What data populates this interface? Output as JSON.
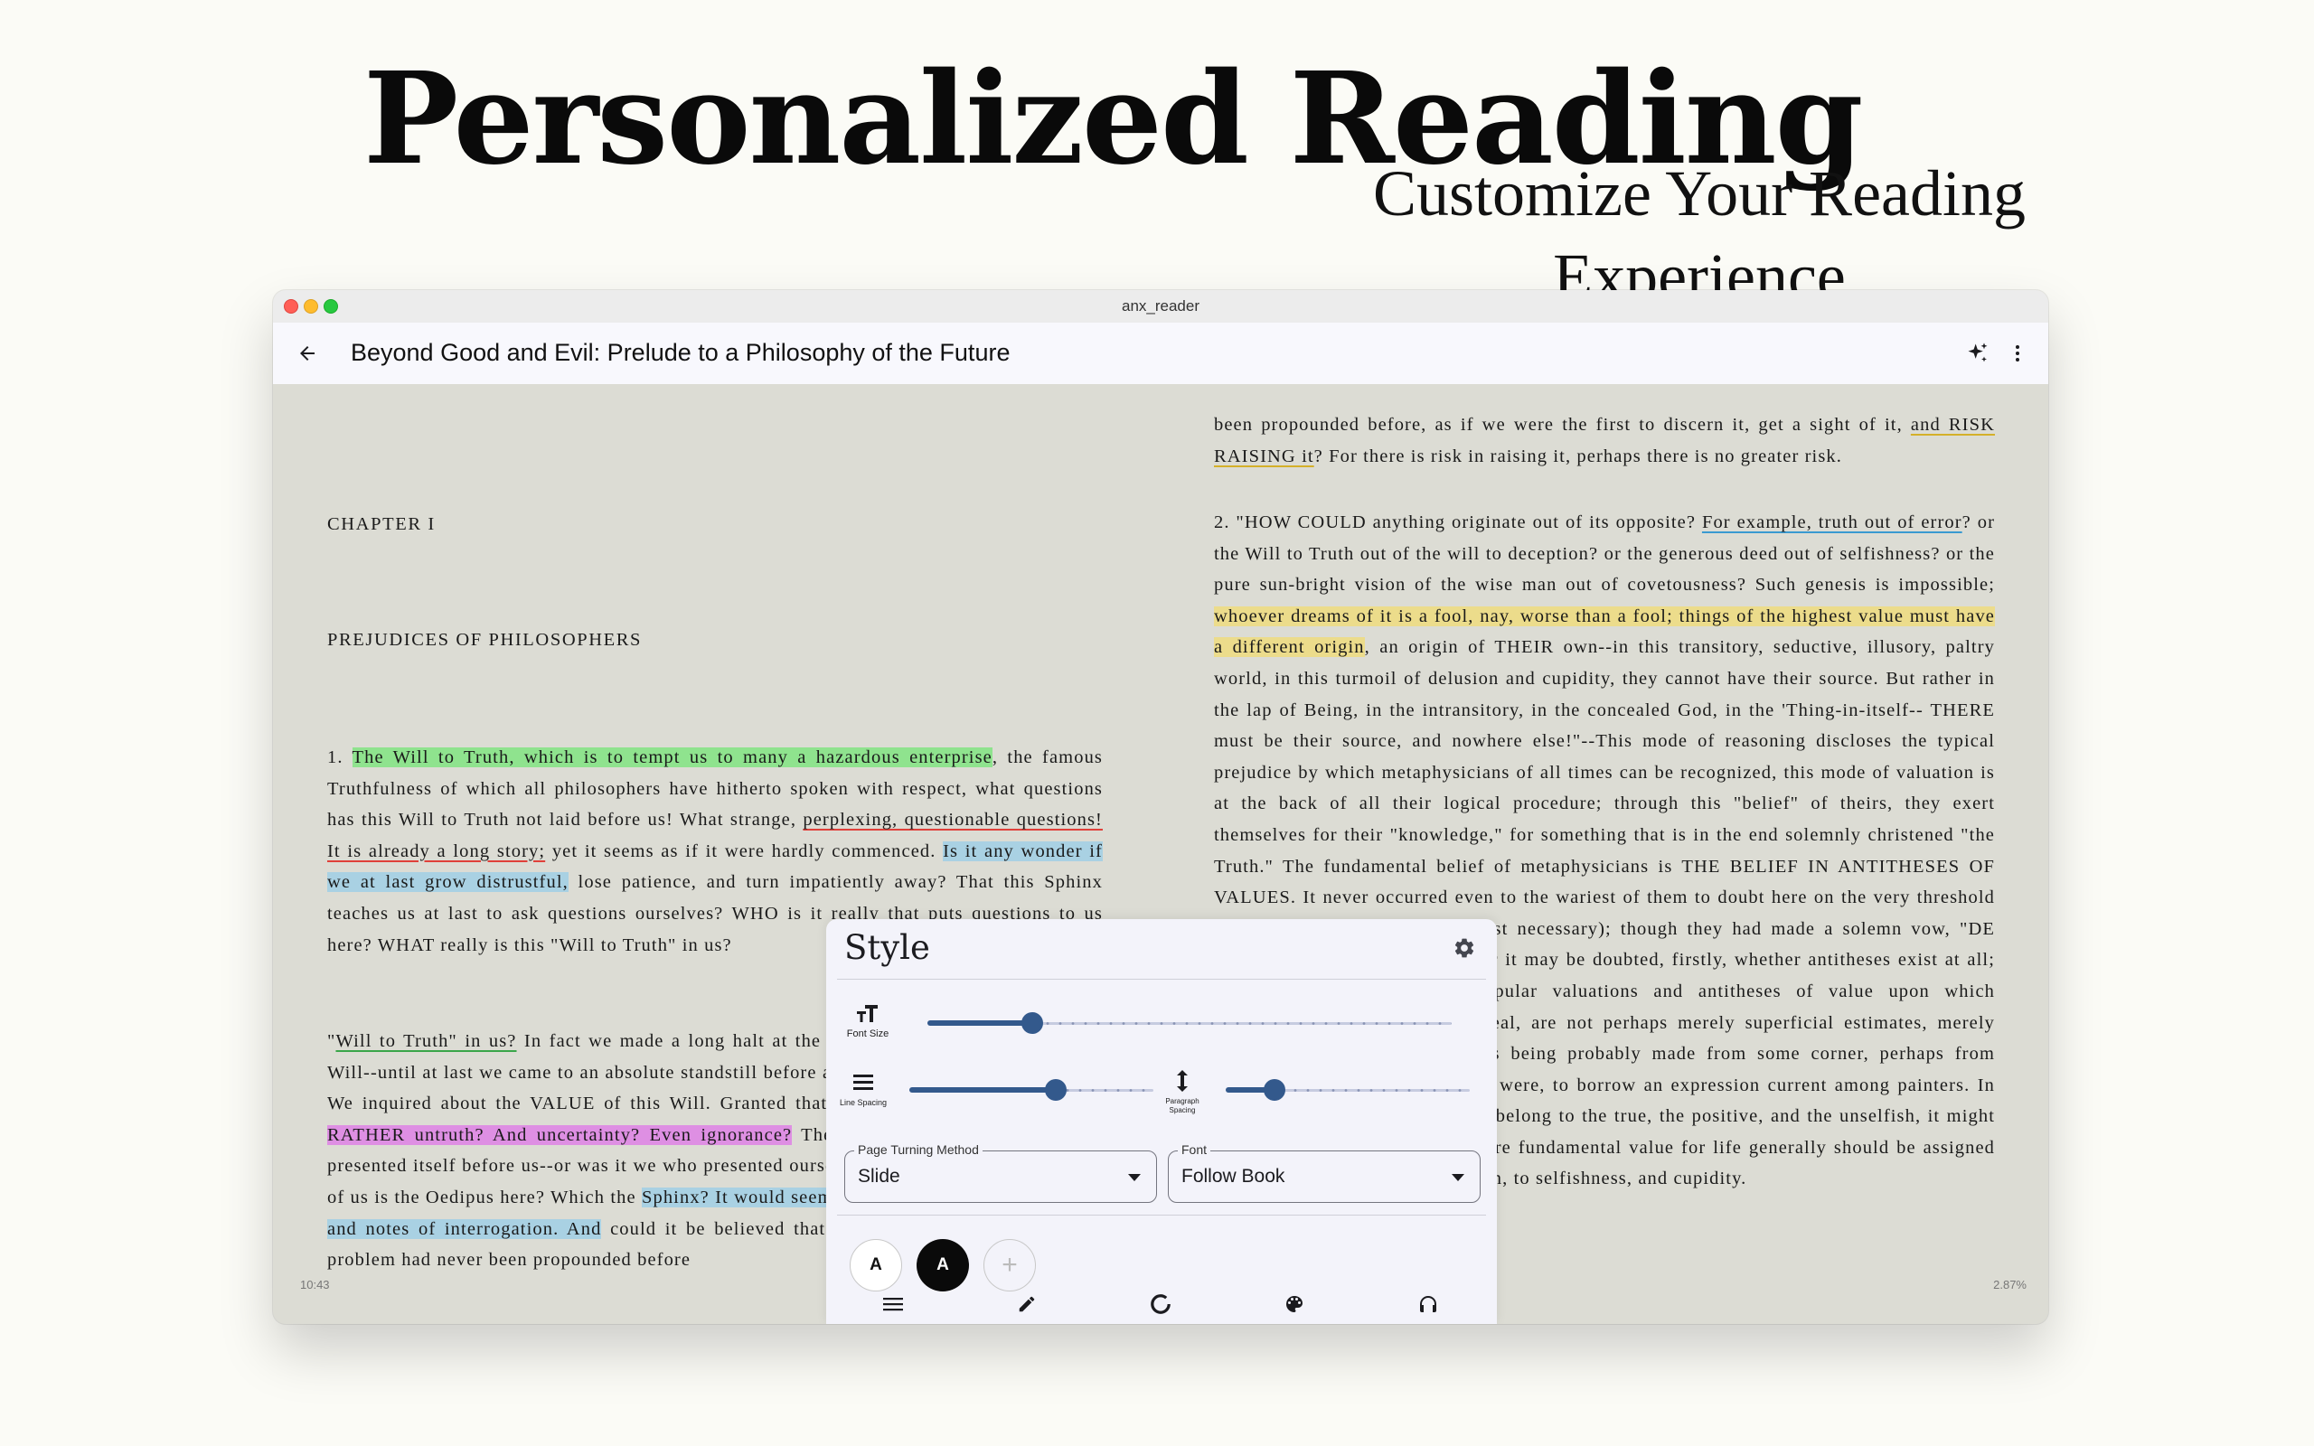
{
  "hero": {
    "title": "Personalized Reading",
    "subtitle": "Customize Your Reading Experience"
  },
  "window": {
    "title": "anx_reader"
  },
  "appbar": {
    "back_icon": "arrow-left-icon",
    "book_title": "Beyond Good and Evil: Prelude to a Philosophy of the Future",
    "ai_icon": "sparkles-icon",
    "more_icon": "more-vert-icon"
  },
  "reader": {
    "chapter": "CHAPTER I",
    "section": "PREJUDICES OF PHILOSOPHERS",
    "left": {
      "p1": [
        {
          "t": "1. "
        },
        {
          "t": "The Will to Truth, which is to tempt us to many a hazardous enterprise",
          "s": "hl-green"
        },
        {
          "t": ", the famous Truthfulness of which all philosophers have hitherto spoken with respect, what questions has this Will to Truth not laid before us! What strange, "
        },
        {
          "t": "perplexing, questionable questions! It is already a long story;",
          "s": "ul-red"
        },
        {
          "t": " yet it seems as if it were hardly commenced. "
        },
        {
          "t": "Is it any wonder if we at last grow distrustful,",
          "s": "hl-blue"
        },
        {
          "t": " lose patience, and turn impatiently away? That this Sphinx teaches us at last to ask questions ourselves? WHO is it really that puts questions to us here? WHAT really is this \"Will to Truth\" in us?"
        }
      ],
      "p2": [
        {
          "t": "\""
        },
        {
          "t": "Will to Truth\" in us?",
          "s": "ul-green"
        },
        {
          "t": " In fact we made a long halt at the question as to the origin of this Will--until at last we came to an absolute standstill before a yet more fundamental question. We inquired about the VALUE of this Will. Granted that we "
        },
        {
          "t": "want the truth: WHY NOT RATHER untruth? And uncertainty? Even ignorance?",
          "s": "hl-purple"
        },
        {
          "t": " The problem of the value of truth presented itself before us--or was it we who presented ourselves before the problem? Which of us is the Oedipus here? Which the "
        },
        {
          "t": "Sphinx? It would seem to be a rendezvous of questions and notes of interrogation. And",
          "s": "hl-blue"
        },
        {
          "t": " could it be believed that it at last seems to us as if the problem had never been propounded before"
        }
      ]
    },
    "right": {
      "p1": [
        {
          "t": "been propounded before, as if we were the first to discern it, get a sight of it, "
        },
        {
          "t": "and RISK RAISING it",
          "s": "ul-yellow"
        },
        {
          "t": "? For there is risk in raising it, perhaps there is no greater risk."
        }
      ],
      "p2": [
        {
          "t": "2. \"HOW COULD anything originate out of its opposite? "
        },
        {
          "t": "For example, truth out of error",
          "s": "ul-blue"
        },
        {
          "t": "? or the Will to Truth out of the will to deception? or the generous deed out of selfishness? or the pure sun-bright vision of the wise man out of covetousness? Such genesis is impossible; "
        },
        {
          "t": "whoever dreams of it is a fool, nay, worse than a fool; things of the highest value must have a different origin",
          "s": "hl-yellow"
        },
        {
          "t": ", an origin of THEIR own--in this transitory, seductive, illusory, paltry world, in this turmoil of delusion and cupidity, they cannot have their source. But rather in the lap of Being, in the intransitory, in the concealed God, in the 'Thing-in-itself-- THERE must be their source, and nowhere else!\"--This mode of reasoning discloses the typical prejudice by which metaphysicians of all times can be recognized, this mode of valuation is at the back of all their logical procedure; through this \"belief\" of theirs, they exert themselves for their \"knowledge,\" for something that is in the end solemnly christened \"the Truth.\" The fundamental belief of metaphysicians is THE BELIEF IN ANTITHESES OF VALUES. It never occurred even to the wariest of them to doubt here on the very threshold (where doubt, however, was most necessary); though they had made a solemn vow, \"DE OMNIBUS DUBITANDUM.\" For it may be doubted, firstly, whether antitheses exist at all; and secondly, whether the popular valuations and antitheses of value upon which metaphysicians have set their seal, are not perhaps merely superficial estimates, merely provisional perspectives, besides being probably made from some corner, perhaps from below--\"frog perspectives,\" as it were, to borrow an expression current among painters. In spite of all the value which may belong to the true, the positive, and the unselfish, it might be possible that a higher and more fundamental value for life generally should be assigned to pretence, to the will to delusion, to selfishness, and cupidity."
        }
      ]
    },
    "time": "10:43",
    "progress": "2.87%"
  },
  "style_panel": {
    "title": "Style",
    "settings_icon": "gear-icon",
    "font_size": {
      "label": "Font Size",
      "icon": "text-size-icon",
      "value": 0.2
    },
    "line_spacing": {
      "label": "Line Spacing",
      "icon": "line-spacing-icon",
      "value": 0.6
    },
    "paragraph_spacing": {
      "label": "Paragraph Spacing",
      "icon": "vertical-arrows-icon",
      "value": 0.2
    },
    "page_turning": {
      "label": "Page Turning Method",
      "value": "Slide"
    },
    "font": {
      "label": "Font",
      "value": "Follow Book"
    },
    "themes": [
      {
        "label": "A",
        "kind": "light"
      },
      {
        "label": "A",
        "kind": "dark"
      },
      {
        "label": "+",
        "kind": "add"
      }
    ],
    "tabs": [
      "toc-list-icon",
      "pencil-icon",
      "progress-ring-icon",
      "palette-icon",
      "headphones-icon"
    ]
  }
}
